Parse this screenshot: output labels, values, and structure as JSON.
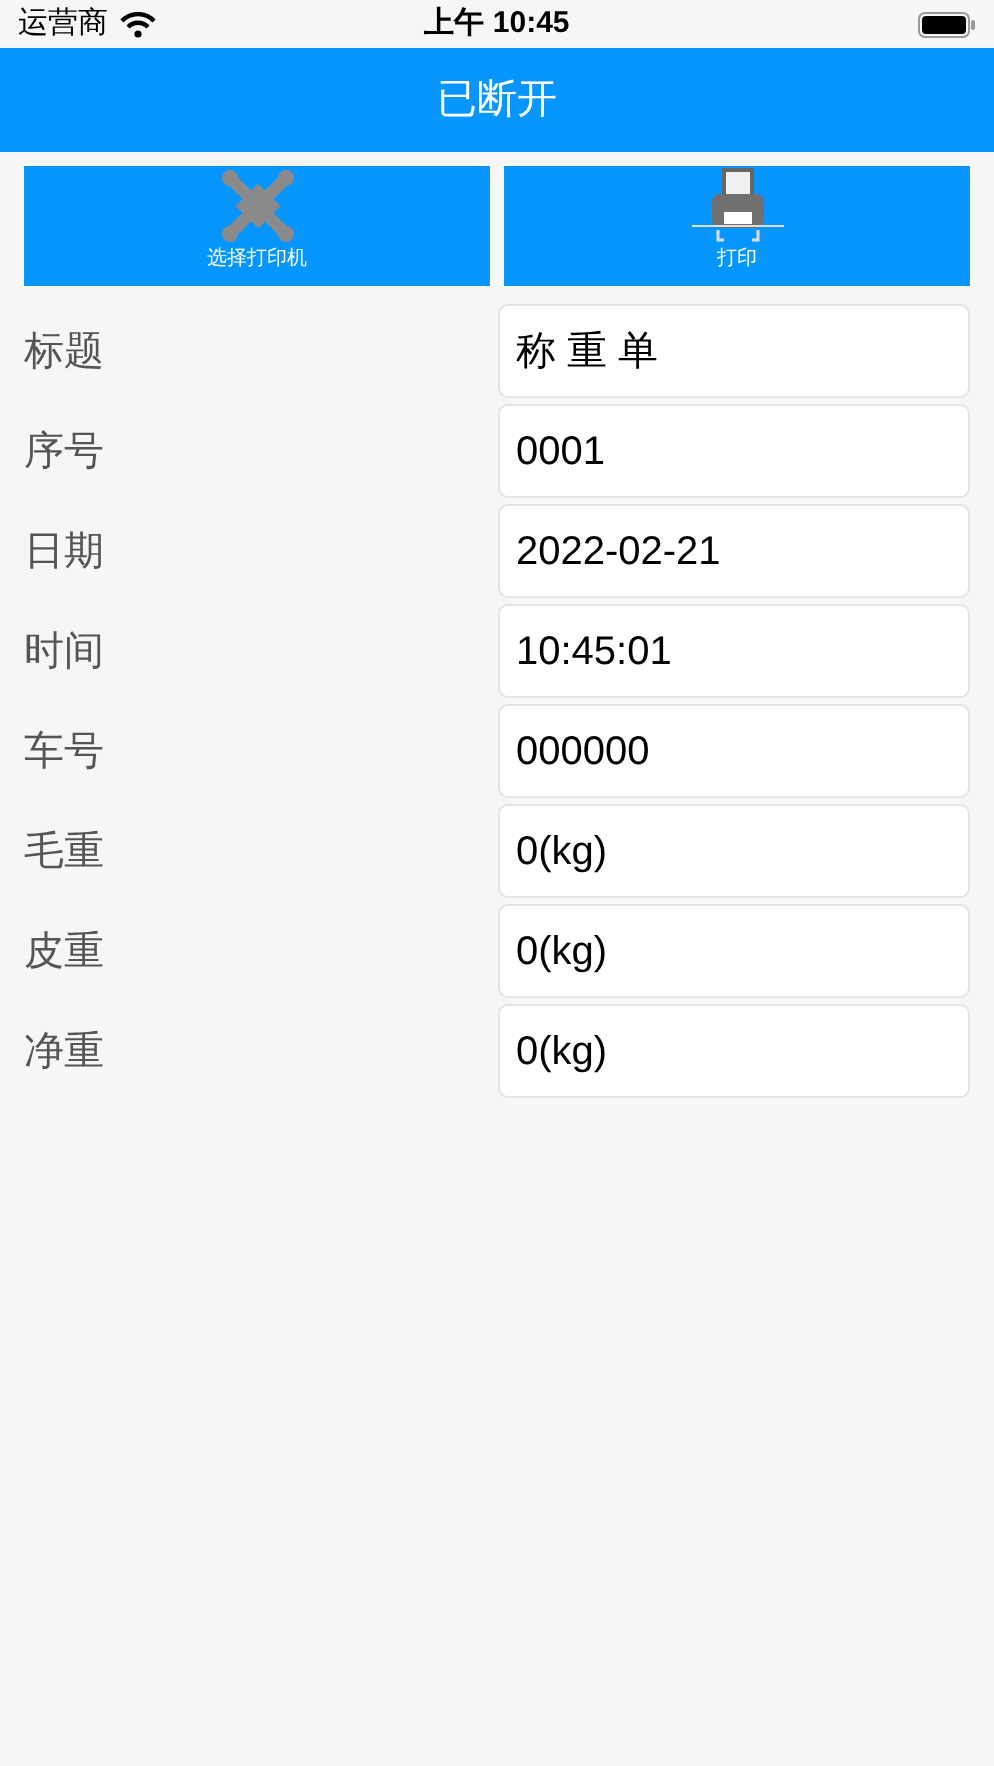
{
  "status_bar": {
    "carrier": "运营商",
    "time": "上午 10:45"
  },
  "nav_bar": {
    "title": "已断开"
  },
  "buttons": [
    {
      "label": "选择打印机",
      "kind": "connect"
    },
    {
      "label": "打印",
      "kind": "print"
    }
  ],
  "fields": [
    {
      "label": "标题",
      "value": "称 重 单"
    },
    {
      "label": "序号",
      "value": "0001"
    },
    {
      "label": "日期",
      "value": "2022-02-21"
    },
    {
      "label": "时间",
      "value": "10:45:01"
    },
    {
      "label": "车号",
      "value": "000000"
    },
    {
      "label": "毛重",
      "value": "0(kg)"
    },
    {
      "label": "皮重",
      "value": "0(kg)"
    },
    {
      "label": "净重",
      "value": "0(kg)"
    }
  ]
}
